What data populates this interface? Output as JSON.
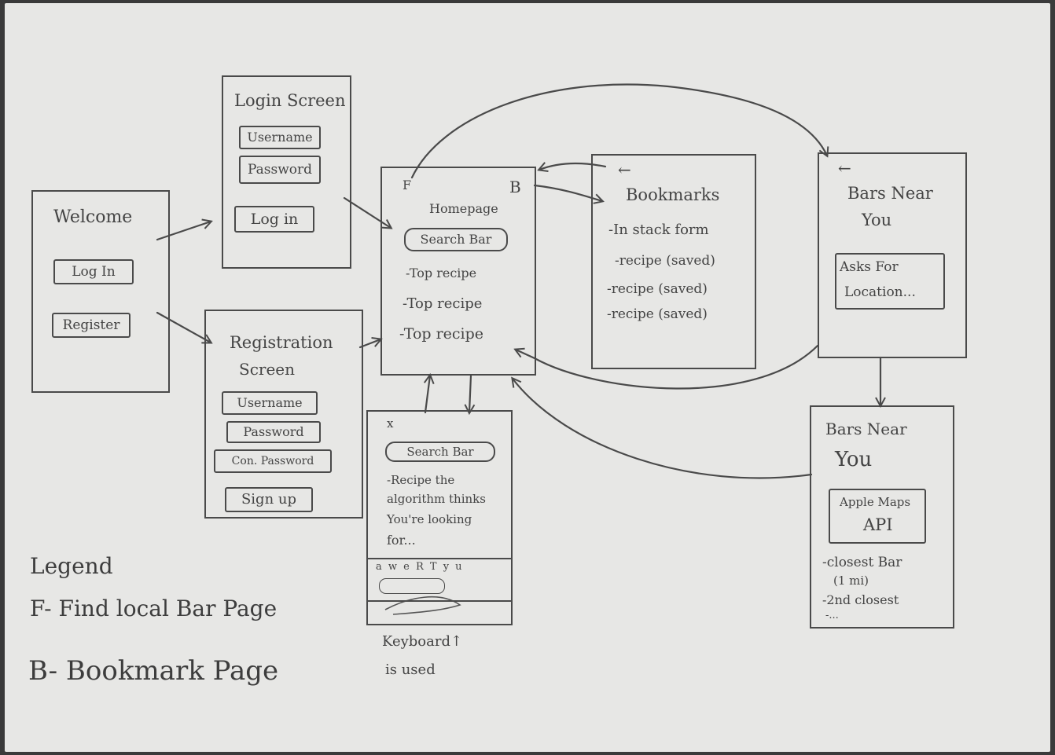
{
  "welcome": {
    "title": "Welcome",
    "login_button": "Log In",
    "register_button": "Register"
  },
  "login_screen": {
    "title": "Login Screen",
    "username": "Username",
    "password": "Password",
    "login_button": "Log in"
  },
  "registration_screen": {
    "title_line1": "Registration",
    "title_line2": "Screen",
    "username": "Username",
    "password": "Password",
    "confirm_password": "Con. Password",
    "signup_button": "Sign up"
  },
  "homepage": {
    "title": "Homepage",
    "search_bar": "Search Bar",
    "items": [
      "-Top recipe",
      "-Top recipe",
      "-Top recipe"
    ],
    "marker_f": "F",
    "marker_b": "B"
  },
  "search_screen": {
    "close": "x",
    "search_bar": "Search Bar",
    "description": [
      "-Recipe the",
      "algorithm thinks",
      "You're looking",
      "for..."
    ],
    "keyboard_row": "a w e R T y u",
    "caption_line1": "Keyboard↑",
    "caption_line2": "is used"
  },
  "bookmarks": {
    "back": "←",
    "title": "Bookmarks",
    "subtitle": "-In stack form",
    "items": [
      "-recipe (saved)",
      "-recipe (saved)",
      "-recipe (saved)"
    ]
  },
  "bars_near_you_1": {
    "back": "←",
    "title_line1": "Bars Near",
    "title_line2": "You",
    "prompt_line1": "Asks For",
    "prompt_line2": "Location..."
  },
  "bars_near_you_2": {
    "title_line1": "Bars Near",
    "title_line2": "You",
    "map_line1": "Apple Maps",
    "map_line2": "API",
    "items": [
      "-closest Bar",
      "(1 mi)",
      "-2nd closest",
      "-..."
    ]
  },
  "legend": {
    "title": "Legend",
    "f_entry": "F- Find local Bar Page",
    "b_entry": "B- Bookmark Page"
  }
}
